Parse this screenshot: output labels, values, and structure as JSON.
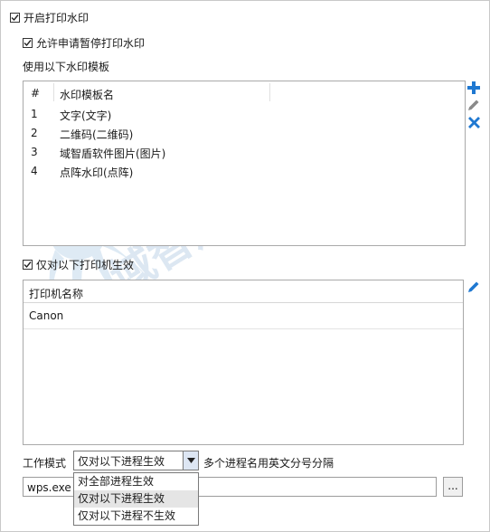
{
  "enable_watermark": {
    "label": "开启打印水印",
    "checked": true
  },
  "allow_pause": {
    "label": "允许申请暂停打印水印",
    "checked": true
  },
  "template_section_label": "使用以下水印模板",
  "template_table": {
    "headers": {
      "num": "#",
      "name": "水印模板名"
    },
    "rows": [
      {
        "num": "1",
        "name": "文字(文字)"
      },
      {
        "num": "2",
        "name": "二维码(二维码)"
      },
      {
        "num": "3",
        "name": "域智盾软件图片(图片)"
      },
      {
        "num": "4",
        "name": "点阵水印(点阵)"
      }
    ]
  },
  "template_actions": {
    "add": "add-icon",
    "edit": "pencil-icon",
    "delete": "delete-icon"
  },
  "printer_only": {
    "label": "仅对以下打印机生效",
    "checked": true
  },
  "printer_table": {
    "header": "打印机名称",
    "rows": [
      "Canon"
    ]
  },
  "work_mode": {
    "label": "工作模式",
    "selected": "仅对以下进程生效",
    "hint": "多个进程名用英文分号分隔",
    "options": [
      "对全部进程生效",
      "仅对以下进程生效",
      "仅对以下进程不生效"
    ],
    "highlighted_option": "仅对以下进程生效"
  },
  "process_input": {
    "value": "wps.exe"
  },
  "browse_button": {
    "label": "..."
  },
  "watermark_brand": "域智盾软件",
  "colors": {
    "accent": "#1f78d1",
    "delete": "#1f78d1",
    "edit": "#8a8a8a"
  }
}
